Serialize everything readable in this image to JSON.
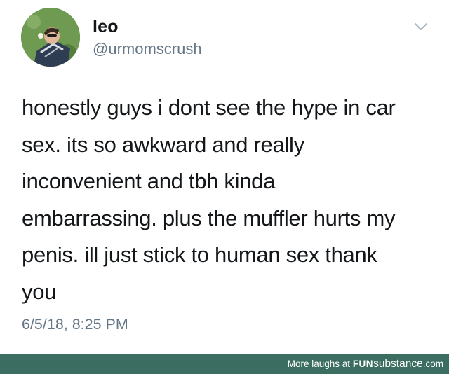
{
  "tweet": {
    "display_name": "leo",
    "handle": "@urmomscrush",
    "body_lines": [
      "honestly guys i dont see the hype in car",
      "sex. its so awkward and really",
      "inconvenient and tbh kinda",
      "embarrassing. plus the muffler hurts my",
      "penis. ill just stick to human sex thank",
      "you"
    ],
    "timestamp": "6/5/18, 8:25 PM",
    "menu_icon": "chevron-down-icon",
    "avatar_icon": "profile-photo"
  },
  "footer": {
    "prefix": "More laughs at",
    "brand_fun": "FUN",
    "brand_sub": "substance",
    "brand_com": ".com"
  },
  "colors": {
    "text_primary": "#14171a",
    "text_secondary": "#657786",
    "footer_bg": "#3b6e61"
  }
}
